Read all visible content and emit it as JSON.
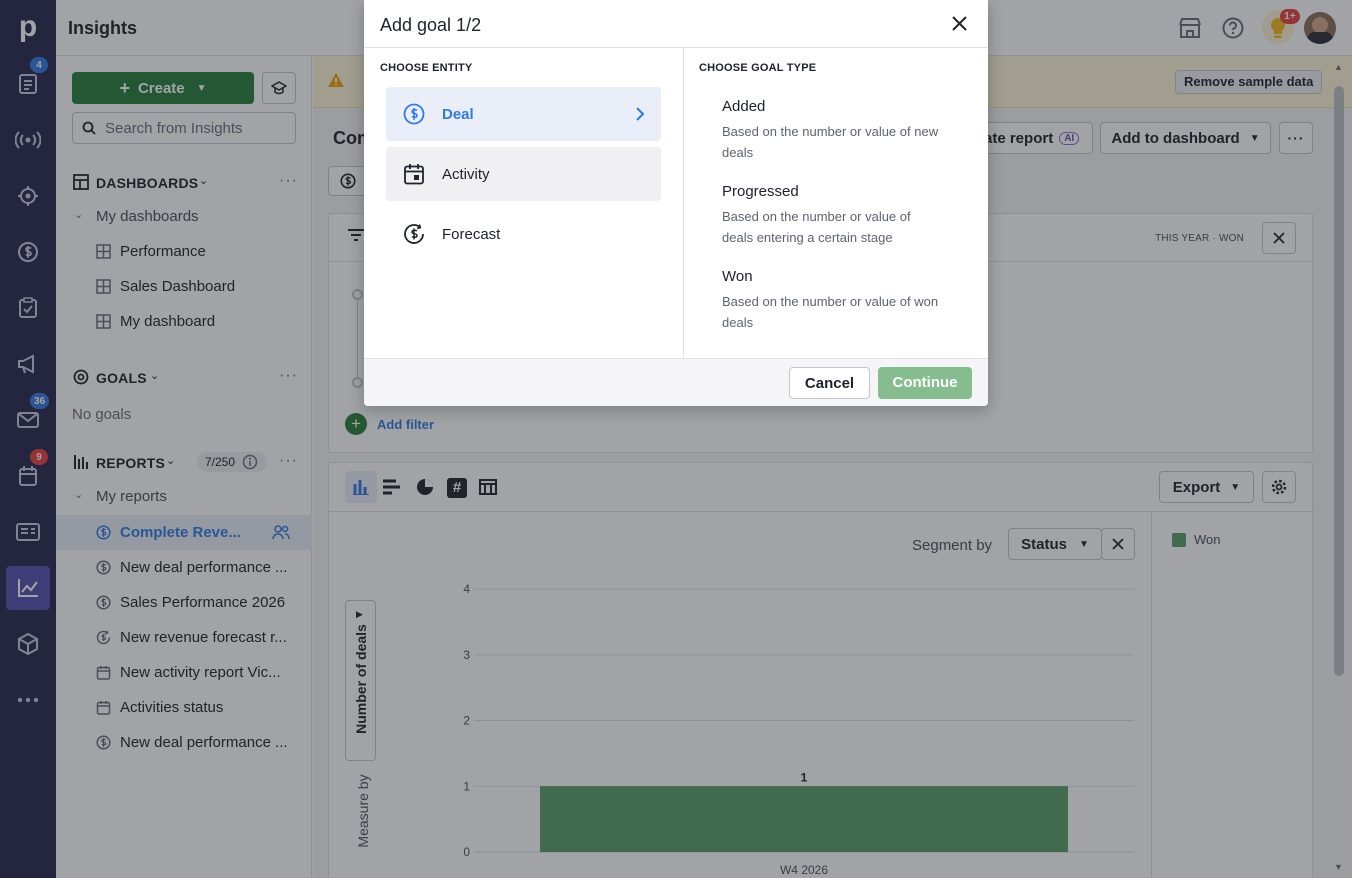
{
  "rail": {
    "logo": "p",
    "badges": {
      "leads": "4",
      "mail": "36",
      "activities": "9"
    },
    "icons": [
      "leads-icon",
      "broadcast-icon",
      "target-icon",
      "deals-icon",
      "tasks-icon",
      "campaigns-icon",
      "mail-icon",
      "calendar-icon",
      "contacts-icon",
      "insights-icon",
      "products-icon",
      "more-icon"
    ]
  },
  "topbar": {
    "title": "Insights",
    "notif_badge": "1+"
  },
  "sidebar": {
    "create_label": "Create",
    "search_placeholder": "Search from Insights",
    "dashboards_title": "DASHBOARDS",
    "my_dashboards": "My dashboards",
    "dashboards": [
      "Performance",
      "Sales Dashboard",
      "My dashboard"
    ],
    "goals_title": "GOALS",
    "no_goals": "No goals",
    "reports_title": "REPORTS",
    "reports_count": "7/250",
    "my_reports": "My reports",
    "reports": [
      {
        "label": "Complete Reve...",
        "icon": "deal-icon"
      },
      {
        "label": "New deal performance ...",
        "icon": "deal-icon"
      },
      {
        "label": "Sales Performance 2026",
        "icon": "deal-icon"
      },
      {
        "label": "New revenue forecast r...",
        "icon": "forecast-icon"
      },
      {
        "label": "New activity report Vic...",
        "icon": "activity-icon"
      },
      {
        "label": "Activities status",
        "icon": "activity-icon"
      },
      {
        "label": "New deal performance ...",
        "icon": "deal-icon"
      }
    ]
  },
  "main": {
    "remove_sample": "Remove sample data",
    "report_title_partial": "Com",
    "create_report_partial": "ate report",
    "ai_badge": "AI",
    "add_to_dashboard": "Add to dashboard",
    "filter_summary": "THIS YEAR · WON",
    "add_filter": "Add filter",
    "export": "Export",
    "segment_by": "Segment by",
    "segment_value": "Status",
    "measure_by": "Measure by",
    "measure_value": "Number of deals",
    "legend": [
      {
        "name": "Won",
        "color": "#5a9e6a"
      }
    ]
  },
  "chart_data": {
    "type": "bar",
    "categories": [
      "W4 2026"
    ],
    "series": [
      {
        "name": "Won",
        "values": [
          1
        ]
      }
    ],
    "ylim": [
      0,
      4
    ],
    "yticks": [
      "0",
      "1",
      "2",
      "3",
      "4"
    ],
    "ylabel": "Number of deals",
    "data_labels": [
      "1"
    ],
    "grid": true,
    "legend_position": "right"
  },
  "modal": {
    "title": "Add goal 1/2",
    "choose_entity": "CHOOSE ENTITY",
    "entities": [
      {
        "label": "Deal",
        "icon": "deal-icon",
        "selected": true
      },
      {
        "label": "Activity",
        "icon": "activity-icon",
        "selected": false
      },
      {
        "label": "Forecast",
        "icon": "forecast-icon",
        "selected": false
      }
    ],
    "choose_goal_type": "CHOOSE GOAL TYPE",
    "goal_types": [
      {
        "title": "Added",
        "desc": "Based on the number or value of new deals"
      },
      {
        "title": "Progressed",
        "desc": "Based on the number or value of deals entering a certain stage"
      },
      {
        "title": "Won",
        "desc": "Based on the number or value of won deals"
      }
    ],
    "cancel": "Cancel",
    "continue": "Continue"
  }
}
